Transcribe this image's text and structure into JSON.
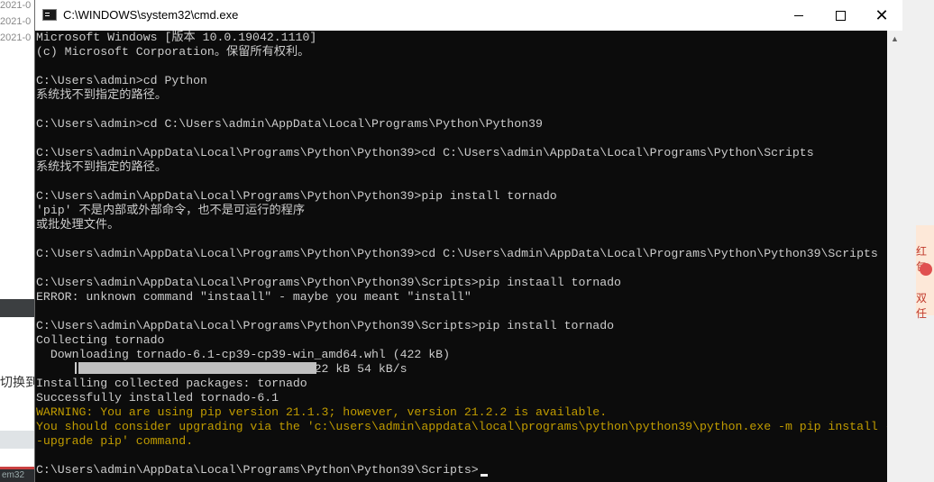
{
  "background": {
    "rows": [
      "2021-0",
      "2021-0",
      "2021-0"
    ],
    "switch_text": "切换到",
    "m32_text": "em32",
    "right_text_1": "红包",
    "right_text_2": "双任"
  },
  "window": {
    "title": "C:\\WINDOWS\\system32\\cmd.exe",
    "minimize_label": "",
    "close_label": "✕"
  },
  "console": {
    "lines": [
      "Microsoft Windows [版本 10.0.19042.1110]",
      "(c) Microsoft Corporation。保留所有权利。",
      "",
      "C:\\Users\\admin>cd Python",
      "系统找不到指定的路径。",
      "",
      "C:\\Users\\admin>cd C:\\Users\\admin\\AppData\\Local\\Programs\\Python\\Python39",
      "",
      "C:\\Users\\admin\\AppData\\Local\\Programs\\Python\\Python39>cd C:\\Users\\admin\\AppData\\Local\\Programs\\Python\\Scripts",
      "系统找不到指定的路径。",
      "",
      "C:\\Users\\admin\\AppData\\Local\\Programs\\Python\\Python39>pip install tornado",
      "'pip' 不是内部或外部命令，也不是可运行的程序",
      "或批处理文件。",
      "",
      "C:\\Users\\admin\\AppData\\Local\\Programs\\Python\\Python39>cd C:\\Users\\admin\\AppData\\Local\\Programs\\Python\\Python39\\Scripts",
      "",
      "C:\\Users\\admin\\AppData\\Local\\Programs\\Python\\Python39\\Scripts>pip instaall tornado",
      "ERROR: unknown command \"instaall\" - maybe you meant \"install\"",
      "",
      "C:\\Users\\admin\\AppData\\Local\\Programs\\Python\\Python39\\Scripts>pip install tornado",
      "Collecting tornado",
      "  Downloading tornado-6.1-cp39-cp39-win_amd64.whl (422 kB)",
      "                                      422 kB 54 kB/s",
      "Installing collected packages: tornado",
      "Successfully installed tornado-6.1",
      "WARNING: You are using pip version 21.1.3; however, version 21.2.2 is available.",
      "You should consider upgrading via the 'c:\\users\\admin\\appdata\\local\\programs\\python\\python39\\python.exe -m pip install -",
      "-upgrade pip' command.",
      "",
      "C:\\Users\\admin\\AppData\\Local\\Programs\\Python\\Python39\\Scripts>"
    ],
    "warning_line_indexes": [
      26,
      27,
      28
    ],
    "download_progress": 1.0,
    "colors": {
      "background": "#0c0c0c",
      "text": "#cccccc",
      "warning": "#c19c00"
    }
  }
}
